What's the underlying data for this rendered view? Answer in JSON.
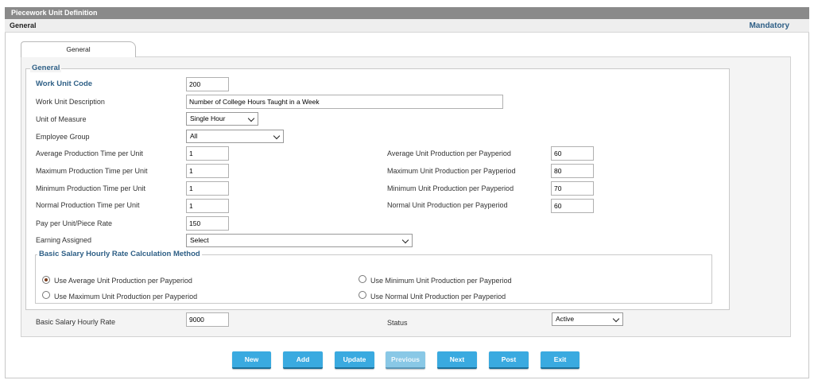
{
  "window": {
    "title": "Piecework Unit Definition"
  },
  "subheader": {
    "left": "General",
    "right": "Mandatory"
  },
  "tabs": [
    {
      "label": "General"
    }
  ],
  "section": {
    "title": "General"
  },
  "fields": {
    "work_unit_code": {
      "label": "Work Unit Code",
      "value": "200"
    },
    "work_unit_description": {
      "label": "Work Unit Description",
      "value": "Number of College Hours Taught in a Week"
    },
    "unit_of_measure": {
      "label": "Unit of Measure",
      "value": "Single Hour"
    },
    "employee_group": {
      "label": "Employee Group",
      "value": "All"
    },
    "avg_production_time": {
      "label": "Average Production Time per Unit",
      "value": "1"
    },
    "max_production_time": {
      "label": "Maximum Production Time per Unit",
      "value": "1"
    },
    "min_production_time": {
      "label": "Minimum Production Time per Unit",
      "value": "1"
    },
    "normal_production_time": {
      "label": "Normal Production Time per Unit",
      "value": "1"
    },
    "pay_per_unit": {
      "label": "Pay per Unit/Piece Rate",
      "value": "150"
    },
    "earning_assigned": {
      "label": "Earning Assigned",
      "value": "Select"
    },
    "avg_unit_production": {
      "label": "Average Unit Production per Payperiod",
      "value": "60"
    },
    "max_unit_production": {
      "label": "Maximum Unit Production per Payperiod",
      "value": "80"
    },
    "min_unit_production": {
      "label": "Minimum Unit Production per Payperiod",
      "value": "70"
    },
    "normal_unit_production": {
      "label": "Normal Unit Production per Payperiod",
      "value": "60"
    },
    "basic_salary_hourly_rate": {
      "label": "Basic Salary Hourly Rate",
      "value": "9000"
    },
    "status": {
      "label": "Status",
      "value": "Active"
    }
  },
  "calc_method": {
    "title": "Basic Salary Hourly Rate Calculation Method",
    "options": [
      {
        "label": "Use Average Unit Production per Payperiod",
        "selected": true
      },
      {
        "label": "Use Minimum Unit Production per Payperiod",
        "selected": false
      },
      {
        "label": "Use Maximum Unit Production per Payperiod",
        "selected": false
      },
      {
        "label": "Use Normal Unit Production per Payperiod",
        "selected": false
      }
    ]
  },
  "buttons": [
    {
      "label": "New",
      "enabled": true
    },
    {
      "label": "Add",
      "enabled": true
    },
    {
      "label": "Update",
      "enabled": true
    },
    {
      "label": "Previous",
      "enabled": false
    },
    {
      "label": "Next",
      "enabled": true
    },
    {
      "label": "Post",
      "enabled": true
    },
    {
      "label": "Exit",
      "enabled": true
    }
  ],
  "colors": {
    "accent": "#2e5f86",
    "button": "#3aaae0",
    "titlebar": "#8a8a8a",
    "radio_selected": "#7a3d1d"
  }
}
